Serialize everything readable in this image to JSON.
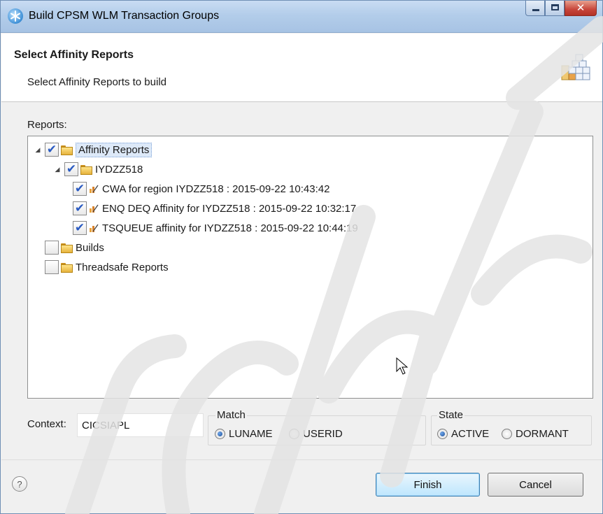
{
  "window": {
    "title": "Build CPSM WLM Transaction Groups",
    "app_icon": "asterisk-snowflake-icon",
    "controls": [
      "minimize",
      "maximize",
      "close"
    ]
  },
  "banner": {
    "title": "Select Affinity Reports",
    "subtitle": "Select Affinity Reports to build",
    "icon": "wizard-blocks-icon"
  },
  "reports": {
    "label": "Reports:",
    "tree": [
      {
        "label": "Affinity Reports",
        "checked": true,
        "expanded": true,
        "selected": true,
        "icon": "folder-icon"
      },
      {
        "label": "IYDZZ518",
        "checked": true,
        "expanded": true,
        "icon": "folder-icon"
      },
      {
        "label": "CWA for region IYDZZ518 : 2015-09-22 10:43:42",
        "checked": true,
        "icon": "report-icon"
      },
      {
        "label": "ENQ DEQ Affinity for IYDZZ518 : 2015-09-22 10:32:17",
        "checked": true,
        "icon": "report-icon"
      },
      {
        "label": "TSQUEUE affinity for IYDZZ518 : 2015-09-22 10:44:19",
        "checked": true,
        "icon": "report-icon"
      },
      {
        "label": "Builds",
        "checked": false,
        "icon": "folder-icon"
      },
      {
        "label": "Threadsafe Reports",
        "checked": false,
        "icon": "folder-icon"
      }
    ]
  },
  "options": {
    "context_label": "Context:",
    "context_value": "CICSIAPL",
    "match": {
      "label": "Match",
      "options": [
        "LUNAME",
        "USERID"
      ],
      "selected": "LUNAME"
    },
    "state": {
      "label": "State",
      "options": [
        "ACTIVE",
        "DORMANT"
      ],
      "selected": "ACTIVE"
    }
  },
  "footer": {
    "help_icon": "help-question-icon",
    "help_glyph": "?",
    "finish_label": "Finish",
    "cancel_label": "Cancel"
  },
  "colors": {
    "titlebar": "#b3cdea",
    "checkmark": "#2a5bc2",
    "finish_border": "#3c7fb1",
    "watermark": "#e4e4e4"
  }
}
